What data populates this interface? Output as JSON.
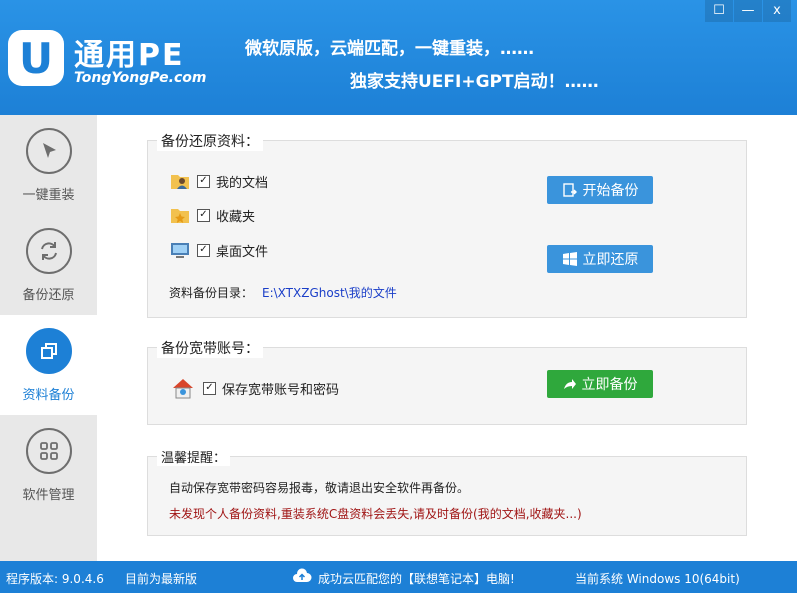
{
  "header": {
    "logo_letter": "U",
    "logo_title": "通用PE",
    "logo_subtitle": "TongYongPe.com",
    "slogan_line1": "微软原版，云端匹配，一键重装，……",
    "slogan_line2": "独家支持UEFI+GPT启动！……",
    "window_controls": {
      "feedback": "☐",
      "minimize": "—",
      "close": "x"
    }
  },
  "sidebar": {
    "items": [
      {
        "label": "一键重装",
        "icon": "cursor-arrow-icon",
        "active": false
      },
      {
        "label": "备份还原",
        "icon": "refresh-arrows-icon",
        "active": false
      },
      {
        "label": "资料备份",
        "icon": "copy-squares-icon",
        "active": true
      },
      {
        "label": "软件管理",
        "icon": "app-grid-icon",
        "active": false
      }
    ]
  },
  "backup_section": {
    "title": "备份还原资料：",
    "items": [
      {
        "label": "我的文档",
        "checked": true,
        "icon": "user-folder-icon"
      },
      {
        "label": "收藏夹",
        "checked": true,
        "icon": "star-folder-icon"
      },
      {
        "label": "桌面文件",
        "checked": true,
        "icon": "desktop-monitor-icon"
      }
    ],
    "start_backup_button": "开始备份",
    "restore_button": "立即还原",
    "path_label": "资料备份目录：",
    "path_value": "E:\\XTXZGhost\\我的文件"
  },
  "broadband_section": {
    "title": "备份宽带账号：",
    "item_label": "保存宽带账号和密码",
    "item_checked": true,
    "backup_button": "立即备份"
  },
  "tips_section": {
    "title": "温馨提醒：",
    "line1": "自动保存宽带密码容易报毒，敬请退出安全软件再备份。",
    "line2": "未发现个人备份资料,重装系统C盘资料会丢失,请及时备份(我的文档,收藏夹...)"
  },
  "statusbar": {
    "version": "程序版本: 9.0.4.6",
    "update_status": "目前为最新版",
    "cloud_message": "成功云匹配您的【联想笔记本】电脑!",
    "system_info": "当前系统 Windows 10(64bit)"
  },
  "colors": {
    "header_blue": "#1d80d6",
    "button_blue": "#3a94dc",
    "button_green": "#2fa83c",
    "warning_red": "#a01515",
    "path_blue": "#1a3ec8"
  }
}
